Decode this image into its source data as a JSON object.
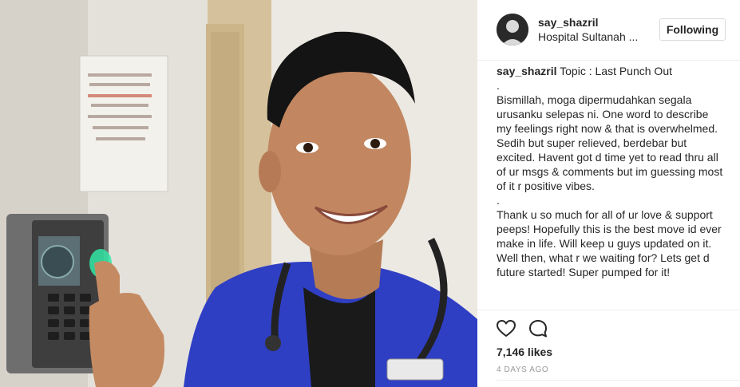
{
  "post": {
    "username": "say_shazril",
    "location": "Hospital Sultanah ...",
    "follow_label": "Following",
    "caption": {
      "username": "say_shazril",
      "lines": [
        "Topic : Last Punch Out",
        ".",
        "Bismillah, moga dipermudahkan segala urusanku selepas ni. One word to describe my feelings right now & that is overwhelmed. Sedih but super relieved, berdebar but excited. Havent got d time yet to read thru all of ur msgs & comments but im guessing most of it r positive vibes.",
        ".",
        "Thank u so much for all of ur love & support peeps! Hopefully this is the best move id ever make in life. Will keep u guys updated on it. Well then, what r we waiting for? Lets get d future started! Super pumped for it!"
      ]
    },
    "likes": "7,146 likes",
    "timestamp": "4 DAYS AGO"
  },
  "icons": {
    "like": "heart-outline-icon",
    "comment": "comment-bubble-icon"
  },
  "colors": {
    "text": "#262626",
    "muted": "#999999",
    "border": "#dbdbdb",
    "scrub": "#2f3fc4"
  }
}
